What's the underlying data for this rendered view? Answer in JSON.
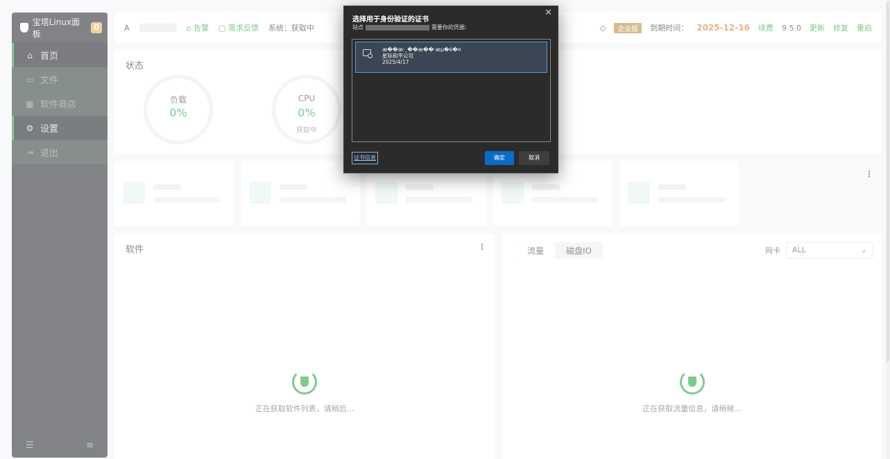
{
  "sidebar": {
    "brand": "宝塔Linux面板",
    "badge": "0",
    "items": [
      {
        "label": "首页",
        "icon": "home-icon",
        "glyph": "⌂"
      },
      {
        "label": "文件",
        "icon": "folder-icon",
        "glyph": "▭"
      },
      {
        "label": "软件商店",
        "icon": "grid-icon",
        "glyph": "▦"
      },
      {
        "label": "设置",
        "icon": "gear-icon",
        "glyph": "⚙"
      },
      {
        "label": "退出",
        "icon": "logout-icon",
        "glyph": "⇥"
      }
    ]
  },
  "topbar": {
    "user_glyph": "A",
    "alert": "告警",
    "feedback": "需求反馈",
    "system": "系统：获取中",
    "edition": "企业版",
    "expire_label": "到期时间：",
    "expire_date": "2025-12-16",
    "renew": "续费",
    "version": "9.5.0",
    "update": "更新",
    "repair": "修复",
    "restart": "重启"
  },
  "status": {
    "title": "状态",
    "load_label": "负载",
    "load_value": "0%",
    "cpu_label": "CPU",
    "cpu_value": "0%",
    "cpu_sub": "获取中"
  },
  "software": {
    "title": "软件",
    "loading": "正在获取软件列表，请稍后..."
  },
  "traffic": {
    "tab_traffic": "流量",
    "tab_disk": "磁盘IO",
    "nic_label": "网卡",
    "nic_value": "ALL",
    "loading": "正在获取流量信息，请稍候..."
  },
  "dialog": {
    "title": "选择用于身份验证的证书",
    "site_prefix": "站点",
    "site_suffix": "需要你的凭据:",
    "cert_name": "æ��æ·¸��æ��·æµ�é�¤",
    "cert_issuer": "星际和平公司",
    "cert_date": "2025/4/17",
    "info_button": "证书信息",
    "ok_button": "确定",
    "cancel_button": "取消",
    "close_glyph": "✕"
  }
}
